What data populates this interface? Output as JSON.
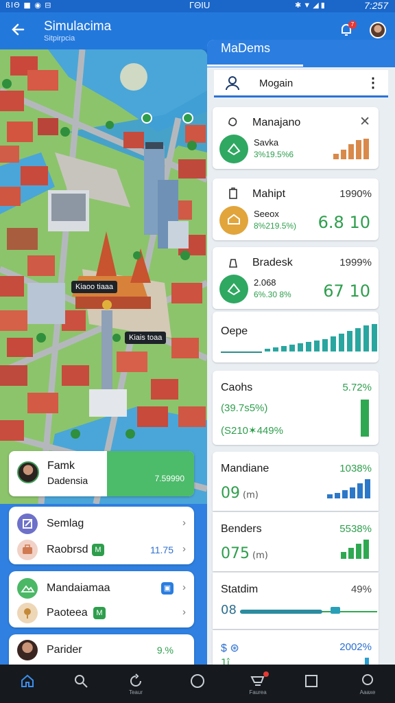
{
  "status_bar": {
    "left": "ßΙΘ ■ ◉ ⊟",
    "center": "ΓΘΙU",
    "right": "7:257"
  },
  "header": {
    "title": "Simulacima",
    "subtitle": "Sitpirpcia",
    "notification_count": "7"
  },
  "map": {
    "labels": [
      "Kiaoo tiaaa",
      "Kiais toaa"
    ]
  },
  "profile": {
    "name": "Famk",
    "subtitle": "Dadensia",
    "value": "7.59990"
  },
  "left_cards": [
    {
      "rows": [
        {
          "label": "Semlag",
          "value": "",
          "icon": "edit-icon"
        },
        {
          "label": "Raobrsd",
          "value": "11.75",
          "icon": "briefcase-icon",
          "badge": "M"
        }
      ]
    },
    {
      "rows": [
        {
          "label": "Mandaiamaa",
          "value": "",
          "icon": "landscape-icon",
          "badge": "image"
        },
        {
          "label": "Paoteea",
          "value": "",
          "icon": "pin-icon",
          "badge": "M"
        }
      ]
    },
    {
      "rows": [
        {
          "label": "Parider",
          "value": "9.%",
          "icon": "avatar-icon"
        }
      ]
    }
  ],
  "right_panel": {
    "title": "MaDems",
    "search_text": "Mogain",
    "cards": [
      {
        "title": "Manajano",
        "line1": "Savka",
        "line2": "3%19.5%6",
        "pct": "",
        "big": ""
      },
      {
        "title": "Mahipt",
        "line1": "Seeox",
        "line2": "8%219.5%)",
        "pct": "1990%",
        "big": "6.8 10"
      },
      {
        "title": "Bradesk",
        "line1": "2.068",
        "line2": "6%.30 8%",
        "pct": "1999%",
        "big": "67 10"
      }
    ],
    "chart": {
      "title": "Oepe"
    },
    "cash": {
      "title": "Caohs",
      "pct": "5.72%",
      "line1": "(39.7s5%)",
      "line2": "(S210✶449%"
    },
    "stats": [
      {
        "title": "Mandiane",
        "pct": "1038%",
        "big": "09",
        "unit": "(m)"
      },
      {
        "title": "Benders",
        "pct": "5538%",
        "big": "075",
        "unit": "(m)"
      },
      {
        "title": "Statdim",
        "pct": "49%",
        "big": "08",
        "unit": ""
      },
      {
        "title": "$ ⊛",
        "pct": "2002%",
        "big": "1î",
        "unit": ""
      }
    ]
  },
  "bottom_nav": [
    {
      "icon": "home-icon",
      "label": ""
    },
    {
      "icon": "search-icon",
      "label": ""
    },
    {
      "icon": "refresh-icon",
      "label": "Teaur"
    },
    {
      "icon": "circle-icon",
      "label": ""
    },
    {
      "icon": "cart-icon",
      "label": "Faurea"
    },
    {
      "icon": "square-icon",
      "label": ""
    },
    {
      "icon": "profile-icon",
      "label": "Aaaxe"
    }
  ]
}
